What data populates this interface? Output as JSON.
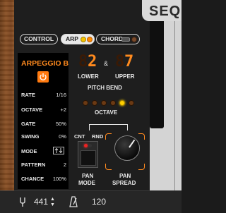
{
  "brand": "SEQ",
  "tabs": {
    "control": "CONTROL",
    "arp": "ARP",
    "chord": "CHORD"
  },
  "arp": {
    "title": "ARPEGGIO B",
    "params": [
      {
        "label": "RATE",
        "value": "1/16"
      },
      {
        "label": "OCTAVE",
        "value": "+2"
      },
      {
        "label": "GATE",
        "value": "50%"
      },
      {
        "label": "SWING",
        "value": "0%"
      },
      {
        "label": "MODE",
        "value": ""
      },
      {
        "label": "PATTERN",
        "value": "2"
      },
      {
        "label": "CHANCE",
        "value": "100%"
      }
    ]
  },
  "pitch_bend": {
    "lower_value": "2",
    "upper_value": "7",
    "amp": "&",
    "lower_label": "LOWER",
    "upper_label": "UPPER",
    "title": "PITCH BEND"
  },
  "octave": {
    "label": "OCTAVE",
    "active_index": 4,
    "count": 6
  },
  "pan": {
    "cnt": "CNT",
    "rnd": "RND",
    "mode_label_1": "PAN",
    "mode_label_2": "MODE",
    "spread_label_1": "PAN",
    "spread_label_2": "SPREAD"
  },
  "bottom": {
    "tuning": "441",
    "stepper": "▲▼",
    "tempo": "120"
  },
  "icons": {
    "tuning": "tuning-fork-icon",
    "metronome": "metronome-icon",
    "power": "power-icon"
  },
  "colors": {
    "accent": "#ff8a1e",
    "led_active": "#ffd000",
    "panel": "#1e1e1e"
  }
}
